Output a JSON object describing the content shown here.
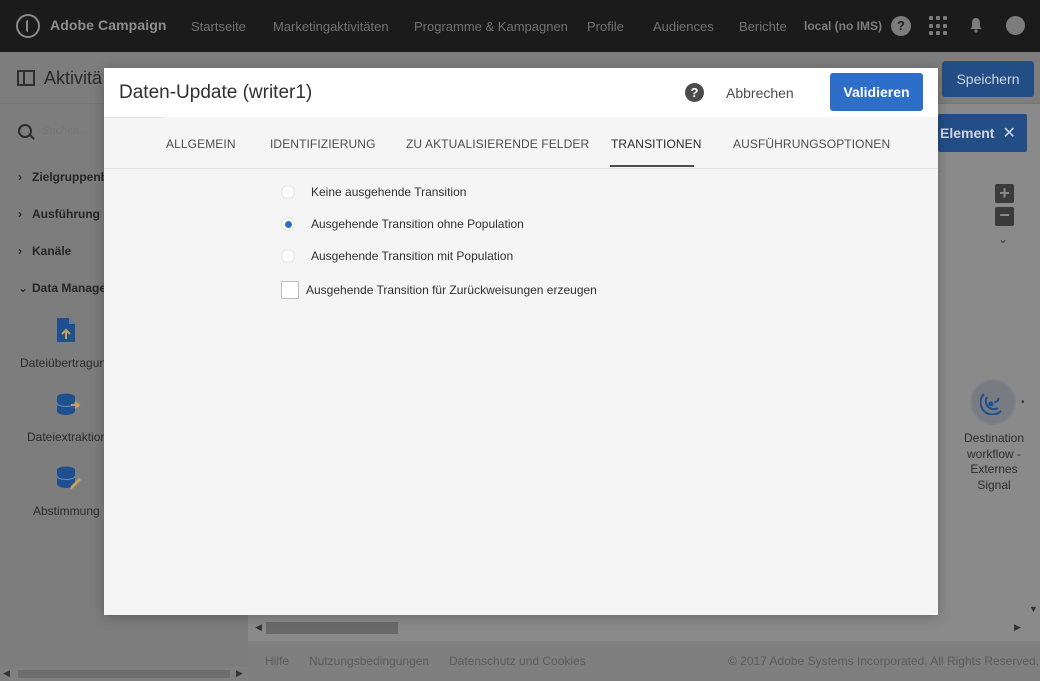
{
  "topnav": {
    "brand": "Adobe Campaign",
    "links": [
      "Startseite",
      "Marketingaktivitäten",
      "Programme & Kampagnen",
      "Profile",
      "Audiences",
      "Berichte"
    ],
    "environment": "local (no IMS)",
    "help_glyph": "?"
  },
  "subbar": {
    "title": "Aktivitä",
    "save_label": "Speichern"
  },
  "sidebar": {
    "search_placeholder": "Suchen...",
    "sections": [
      {
        "label": "Zielgruppenb",
        "chevron": "›"
      },
      {
        "label": "Ausführung",
        "chevron": "›"
      },
      {
        "label": "Kanäle",
        "chevron": "›"
      },
      {
        "label": "Data Manage",
        "chevron": "⌄"
      }
    ],
    "items": [
      {
        "label": "Dateiübertragun",
        "icon": "file-upload-icon"
      },
      {
        "label": "Dateiextraktion",
        "icon": "database-export-icon"
      },
      {
        "label": "Abstimmung",
        "icon": "database-edit-icon"
      }
    ]
  },
  "canvas": {
    "element_label": "Element",
    "node_label": "Destination workflow - Externes Signal",
    "node_icon": "signal-icon"
  },
  "footer": {
    "links": [
      "Hilfe",
      "Nutzungsbedingungen",
      "Datenschutz und Cookies"
    ],
    "copyright": "© 2017 Adobe Systems Incorporated. All Rights Reserved."
  },
  "modal": {
    "title": "Daten-Update (writer1)",
    "help_glyph": "?",
    "cancel_label": "Abbrechen",
    "validate_label": "Validieren",
    "tabs": [
      {
        "label": "ALLGEMEIN",
        "active": false
      },
      {
        "label": "IDENTIFIZIERUNG",
        "active": false
      },
      {
        "label": "ZU AKTUALISIERENDE FELDER",
        "active": false
      },
      {
        "label": "TRANSITIONEN",
        "active": true
      },
      {
        "label": "AUSFÜHRUNGSOPTIONEN",
        "active": false
      }
    ],
    "transition_options": [
      {
        "label": "Keine ausgehende Transition",
        "checked": false
      },
      {
        "label": "Ausgehende Transition ohne Population",
        "checked": true
      },
      {
        "label": "Ausgehende Transition mit Population",
        "checked": false
      }
    ],
    "rejection_checkbox": {
      "label": "Ausgehende Transition für Zurückweisungen erzeugen",
      "checked": false
    }
  },
  "colors": {
    "accent": "#2d6ec9",
    "nav_bg": "#1b1b1b",
    "overlay_dim": "#808080"
  }
}
